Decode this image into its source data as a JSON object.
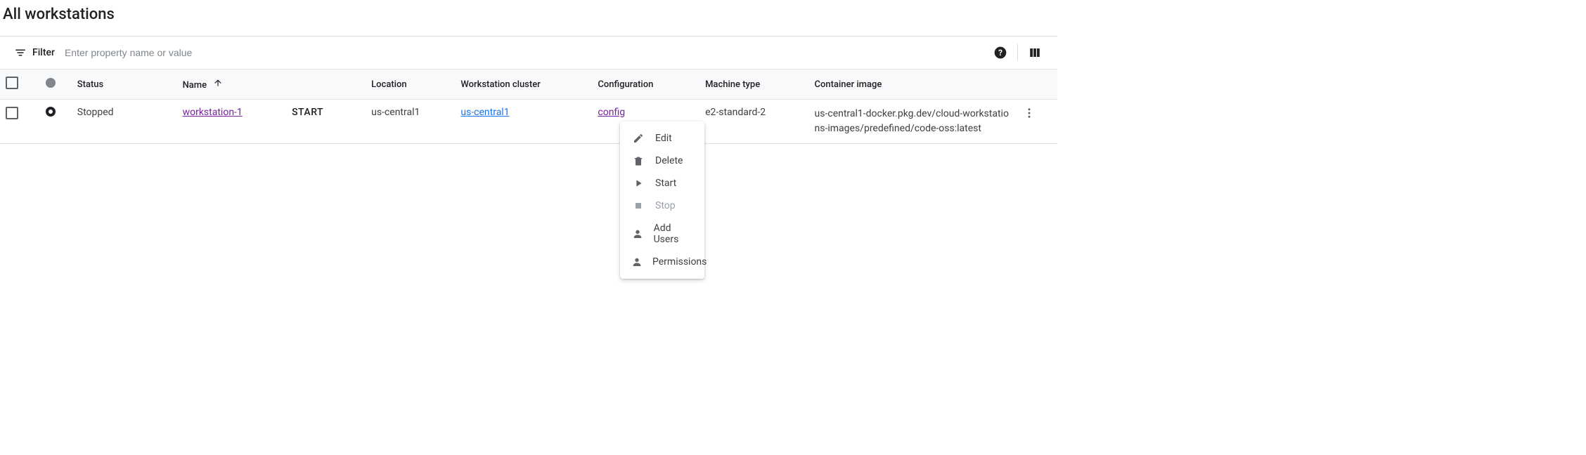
{
  "page_title": "All workstations",
  "filter": {
    "label": "Filter",
    "placeholder": "Enter property name or value"
  },
  "columns": {
    "status": "Status",
    "name": "Name",
    "location": "Location",
    "cluster": "Workstation cluster",
    "config": "Configuration",
    "machine": "Machine type",
    "image": "Container image"
  },
  "row": {
    "status": "Stopped",
    "name": "workstation-1",
    "action": "START",
    "location": "us-central1",
    "cluster": "us-central1",
    "config": "config",
    "machine": "e2-standard-2",
    "image": "us-central1-docker.pkg.dev/cloud-workstations-images/predefined/code-oss:latest"
  },
  "menu": {
    "edit": "Edit",
    "delete": "Delete",
    "start": "Start",
    "stop": "Stop",
    "add_users": "Add Users",
    "permissions": "Permissions"
  }
}
